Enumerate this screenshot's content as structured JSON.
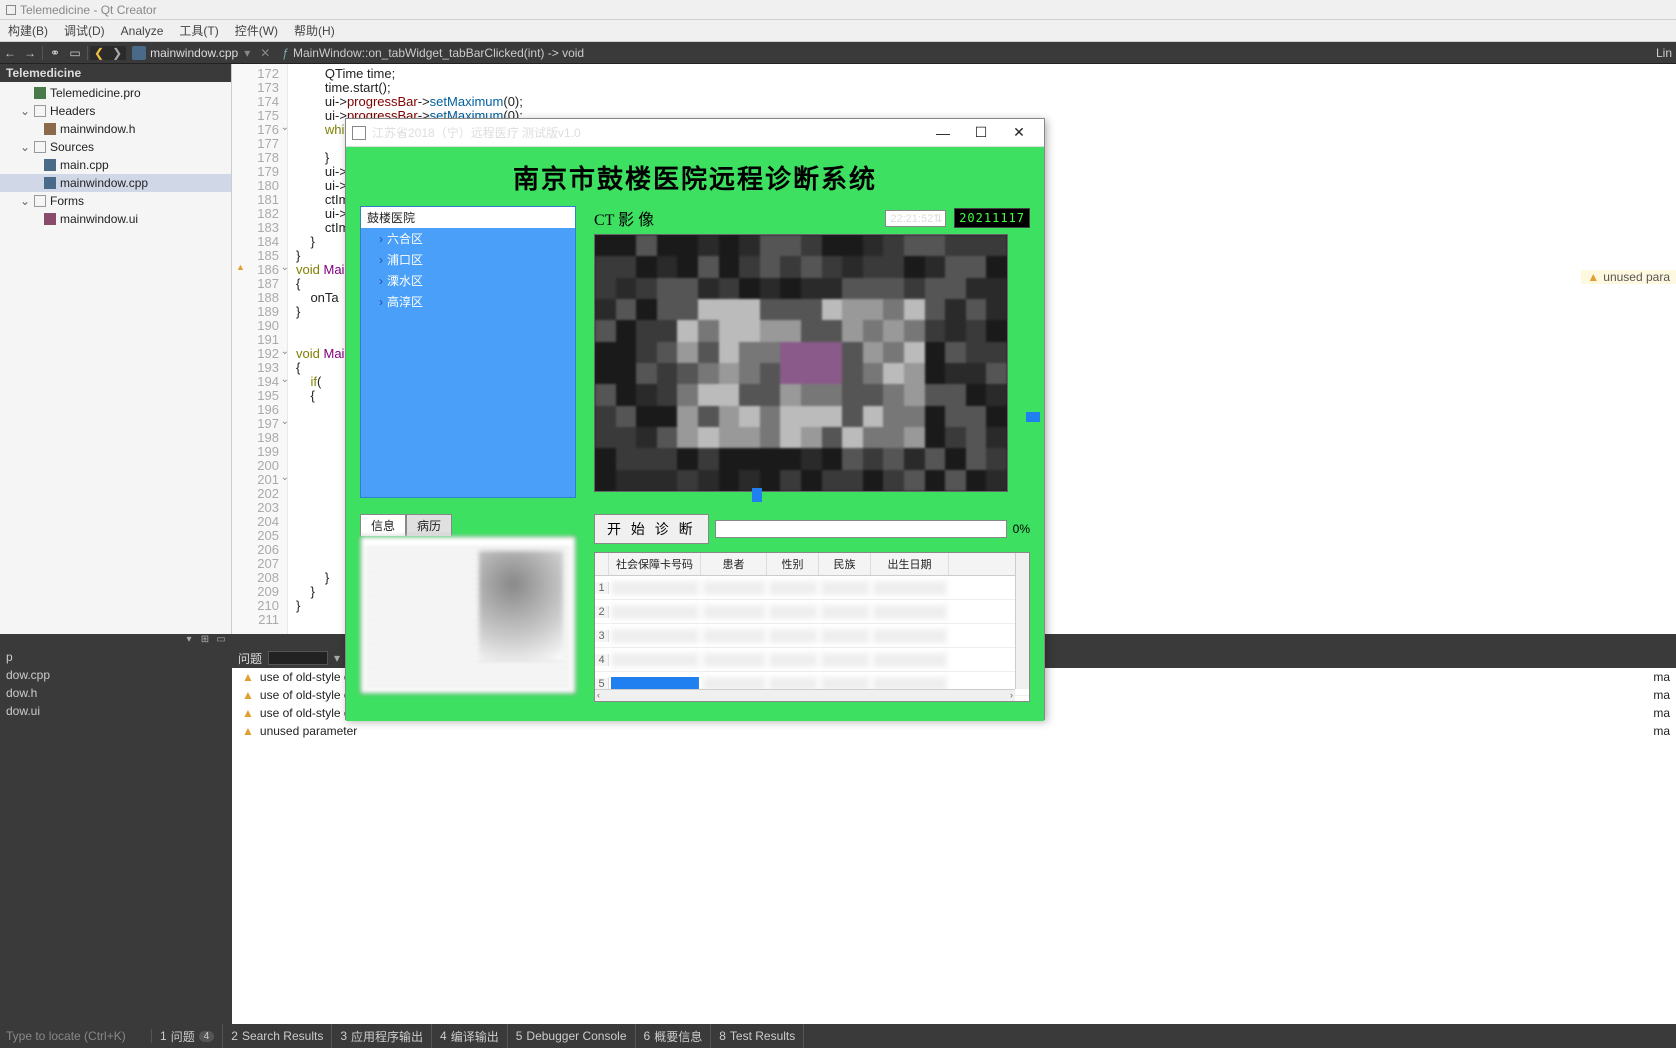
{
  "titlebar": {
    "text": "Telemedicine - Qt Creator"
  },
  "menu": [
    "构建(B)",
    "调试(D)",
    "Analyze",
    "工具(T)",
    "控件(W)",
    "帮助(H)"
  ],
  "crumb": {
    "file": "mainwindow.cpp",
    "func": "MainWindow::on_tabWidget_tabBarClicked(int) -> void",
    "right": "Lin"
  },
  "project": {
    "header": "Telemedicine",
    "tree": [
      {
        "icon": "pro",
        "label": "Telemedicine.pro",
        "ind": 1
      },
      {
        "icon": "fold",
        "label": "Headers",
        "ind": 1,
        "exp": "⌄"
      },
      {
        "icon": "h",
        "label": "mainwindow.h",
        "ind": 2
      },
      {
        "icon": "fold",
        "label": "Sources",
        "ind": 1,
        "exp": "⌄"
      },
      {
        "icon": "cpp",
        "label": "main.cpp",
        "ind": 2
      },
      {
        "icon": "cpp",
        "label": "mainwindow.cpp",
        "ind": 2,
        "sel": true
      },
      {
        "icon": "fold",
        "label": "Forms",
        "ind": 1,
        "exp": "⌄"
      },
      {
        "icon": "ui",
        "label": "mainwindow.ui",
        "ind": 2
      }
    ]
  },
  "editor": {
    "lines": [
      {
        "n": 172,
        "t": "        QTime time;"
      },
      {
        "n": 173,
        "t": "        time.start();"
      },
      {
        "n": 174,
        "html": "        ui-><span class=ptr>progressBar</span>-><span class=fn>setMaximum</span>(0);"
      },
      {
        "n": 175,
        "html": "        ui-><span class=ptr>progressBar</span>-><span class=fn>setMaximum</span>(0);"
      },
      {
        "n": 176,
        "html": "        <span class=kw>whil</span>",
        "fold": true
      },
      {
        "n": 177,
        "t": ""
      },
      {
        "n": 178,
        "t": "        }"
      },
      {
        "n": 179,
        "t": "        ui->"
      },
      {
        "n": 180,
        "t": "        ui->"
      },
      {
        "n": 181,
        "t": "        ctIm"
      },
      {
        "n": 182,
        "t": "        ui->"
      },
      {
        "n": 183,
        "t": "        ctIm"
      },
      {
        "n": 184,
        "t": "    }"
      },
      {
        "n": 185,
        "t": "}"
      },
      {
        "n": 186,
        "html": "<span class=kw>void</span> <span class=cls>Mai</span>",
        "warn": true,
        "fold": true
      },
      {
        "n": 187,
        "t": "{"
      },
      {
        "n": 188,
        "t": "    onTa"
      },
      {
        "n": 189,
        "t": "}"
      },
      {
        "n": 190,
        "t": ""
      },
      {
        "n": 191,
        "t": ""
      },
      {
        "n": 192,
        "html": "<span class=kw>void</span> <span class=cls>Mai</span>",
        "fold": true
      },
      {
        "n": 193,
        "t": "{"
      },
      {
        "n": 194,
        "html": "    <span class=kw>if</span>(",
        "fold": true
      },
      {
        "n": 195,
        "t": "    {"
      },
      {
        "n": 196,
        "t": ""
      },
      {
        "n": 197,
        "fold": true,
        "t": ""
      },
      {
        "n": 198,
        "t": ""
      },
      {
        "n": 199,
        "t": ""
      },
      {
        "n": 200,
        "t": ""
      },
      {
        "n": 201,
        "fold": true,
        "t": ""
      },
      {
        "n": 202,
        "t": ""
      },
      {
        "n": 203,
        "t": ""
      },
      {
        "n": 204,
        "t": ""
      },
      {
        "n": 205,
        "t": ""
      },
      {
        "n": 206,
        "t": ""
      },
      {
        "n": 207,
        "t": ""
      },
      {
        "n": 208,
        "t": "        }"
      },
      {
        "n": 209,
        "t": "    }"
      },
      {
        "n": 210,
        "t": "}"
      },
      {
        "n": 211,
        "t": ""
      }
    ],
    "warn_inline": "unused para"
  },
  "openeds": [
    "p",
    "dow.cpp",
    "dow.h",
    "dow.ui"
  ],
  "issues": {
    "title": "问题",
    "rows": [
      {
        "msg": "use of old-style cas",
        "file": "ma"
      },
      {
        "msg": "use of old-style cas",
        "file": "ma"
      },
      {
        "msg": "use of old-style cas",
        "file": "ma"
      },
      {
        "msg": "unused parameter",
        "file": "ma"
      }
    ]
  },
  "status": {
    "locate": "Type to locate (Ctrl+K)",
    "tabs": [
      {
        "n": "1",
        "l": "问题",
        "b": "4"
      },
      {
        "n": "2",
        "l": "Search Results"
      },
      {
        "n": "3",
        "l": "应用程序输出"
      },
      {
        "n": "4",
        "l": "编译输出"
      },
      {
        "n": "5",
        "l": "Debugger Console"
      },
      {
        "n": "6",
        "l": "概要信息"
      },
      {
        "n": "8",
        "l": "Test Results"
      }
    ]
  },
  "dialog": {
    "window_title": "江苏省2018（宁）远程医疗 测试版v1.0",
    "title": "南京市鼓楼医院远程诊断系统",
    "tree_root": "鼓楼医院",
    "tree_items": [
      "六合区",
      "浦口区",
      "溧水区",
      "高淳区"
    ],
    "ct_label": "CT 影 像",
    "time": "22:21:52",
    "date": "20211117",
    "tabs": [
      "信息",
      "病历"
    ],
    "diag_btn": "开 始 诊 断",
    "progress_pct": "0%",
    "cols": [
      "社会保障卡号码",
      "患者",
      "性别",
      "民族",
      "出生日期"
    ],
    "rows": [
      1,
      2,
      3,
      4,
      5
    ]
  }
}
